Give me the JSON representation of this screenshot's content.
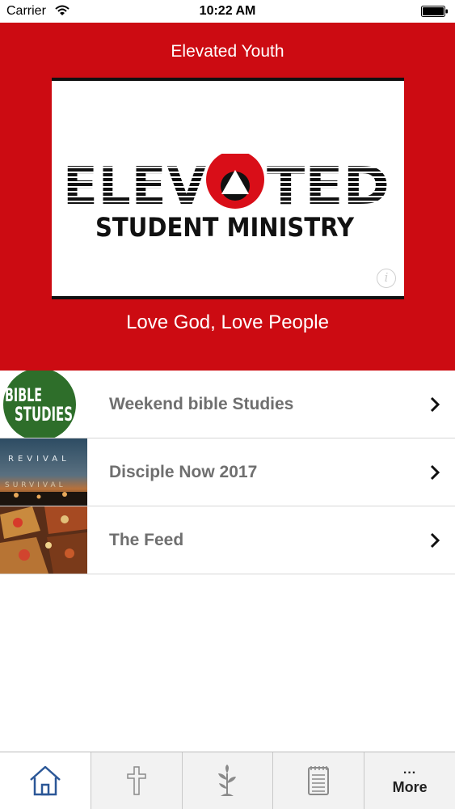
{
  "status_bar": {
    "carrier": "Carrier",
    "time": "10:22 AM"
  },
  "header": {
    "title": "Elevated Youth",
    "logo_text_main": "ELEVATED",
    "logo_text_sub": "STUDENT MINISTRY",
    "tagline": "Love God, Love People",
    "background_color": "#cc0b12"
  },
  "list": {
    "items": [
      {
        "label": "Weekend bible Studies",
        "thumb_text": [
          "BIBLE",
          "STUDIES"
        ]
      },
      {
        "label": "Disciple Now 2017",
        "thumb_text": [
          "REVIVAL",
          "SURVIVAL"
        ]
      },
      {
        "label": "The Feed",
        "thumb_text": []
      }
    ]
  },
  "tab_bar": {
    "tabs": [
      {
        "icon": "home-icon",
        "active": true
      },
      {
        "icon": "cross-icon",
        "active": false
      },
      {
        "icon": "plant-icon",
        "active": false
      },
      {
        "icon": "notepad-icon",
        "active": false
      },
      {
        "icon": "more-icon",
        "label": "More",
        "dots": "..."
      }
    ],
    "active_color": "#2b5797"
  }
}
